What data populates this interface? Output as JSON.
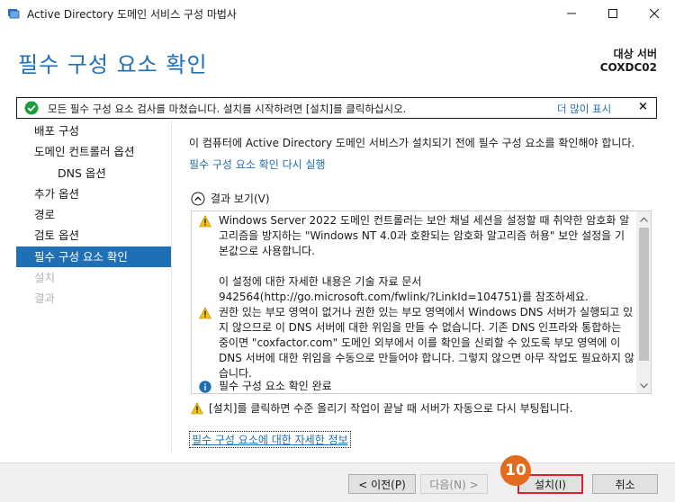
{
  "window": {
    "title": "Active Directory 도메인 서비스 구성 마법사",
    "minimize_icon": "minimize-icon",
    "maximize_icon": "maximize-icon",
    "close_icon": "close-icon"
  },
  "header": {
    "page_title": "필수 구성 요소 확인",
    "target_label": "대상 서버",
    "target_name": "COXDC02"
  },
  "notification": {
    "text": "모든 필수 구성 요소 검사를 마쳤습니다. 설치를 시작하려면 [설치]를 클릭하십시오.",
    "more_label": "더 많이 표시",
    "close_label": "×"
  },
  "sidebar": {
    "items": [
      {
        "label": "배포 구성",
        "state": "normal"
      },
      {
        "label": "도메인 컨트롤러 옵션",
        "state": "normal"
      },
      {
        "label": "DNS 옵션",
        "state": "normal"
      },
      {
        "label": "추가 옵션",
        "state": "normal"
      },
      {
        "label": "경로",
        "state": "normal"
      },
      {
        "label": "검토 옵션",
        "state": "normal"
      },
      {
        "label": "필수 구성 요소 확인",
        "state": "active"
      },
      {
        "label": "설치",
        "state": "disabled"
      },
      {
        "label": "결과",
        "state": "disabled"
      }
    ]
  },
  "main": {
    "intro": "이 컴퓨터에 Active Directory 도메인 서비스가 설치되기 전에 필수 구성 요소를 확인해야 합니다.",
    "rerun_link": "필수 구성 요소 확인 다시 실행",
    "toggle_label": "결과 보기(V)",
    "results": [
      {
        "type": "warning",
        "text": "Windows Server 2022 도메인 컨트롤러는 보안 채널 세션을 설정할 때 취약한 암호화 알고리즘을 방지하는 \"Windows NT 4.0과 호환되는 암호화 알고리즘 허용\" 보안 설정을 기본값으로 사용합니다.",
        "text2": "이 설정에 대한 자세한 내용은 기술 자료 문서 942564(http://go.microsoft.com/fwlink/?LinkId=104751)를 참조하세요."
      },
      {
        "type": "warning",
        "text": "권한 있는 부모 영역이 없거나 권한 있는 부모 영역에서 Windows DNS 서버가 실행되고 있지 않으므로 이 DNS 서버에 대한 위임을 만들 수 없습니다. 기존 DNS 인프라와 통합하는 중이면 \"coxfactor.com\" 도메인 외부에서 이를 확인을 신뢰할 수 있도록 부모 영역에 이 DNS 서버에 대한 위임을 수동으로 만들어야 합니다. 그렇지 않으면 아무 작업도 필요하지 않습니다."
      },
      {
        "type": "info",
        "text": "필수 구성 요소 확인 완료"
      }
    ],
    "reboot_warning": "[설치]를 클릭하면 수준 올리기 작업이 끝날 때 서버가 자동으로 다시 부팅됩니다.",
    "more_info_link": "필수 구성 요소에 대한 자세한 정보"
  },
  "footer": {
    "prev_label": "< 이전(P)",
    "next_label": "다음(N) >",
    "install_label": "설치(I)",
    "cancel_label": "취소"
  },
  "annotation": {
    "step_number": "10"
  },
  "colors": {
    "accent": "#1f6fb5",
    "warning": "#f5c400",
    "success": "#1e9e3a",
    "highlight": "#e0202a",
    "badge": "#e26b1f"
  }
}
